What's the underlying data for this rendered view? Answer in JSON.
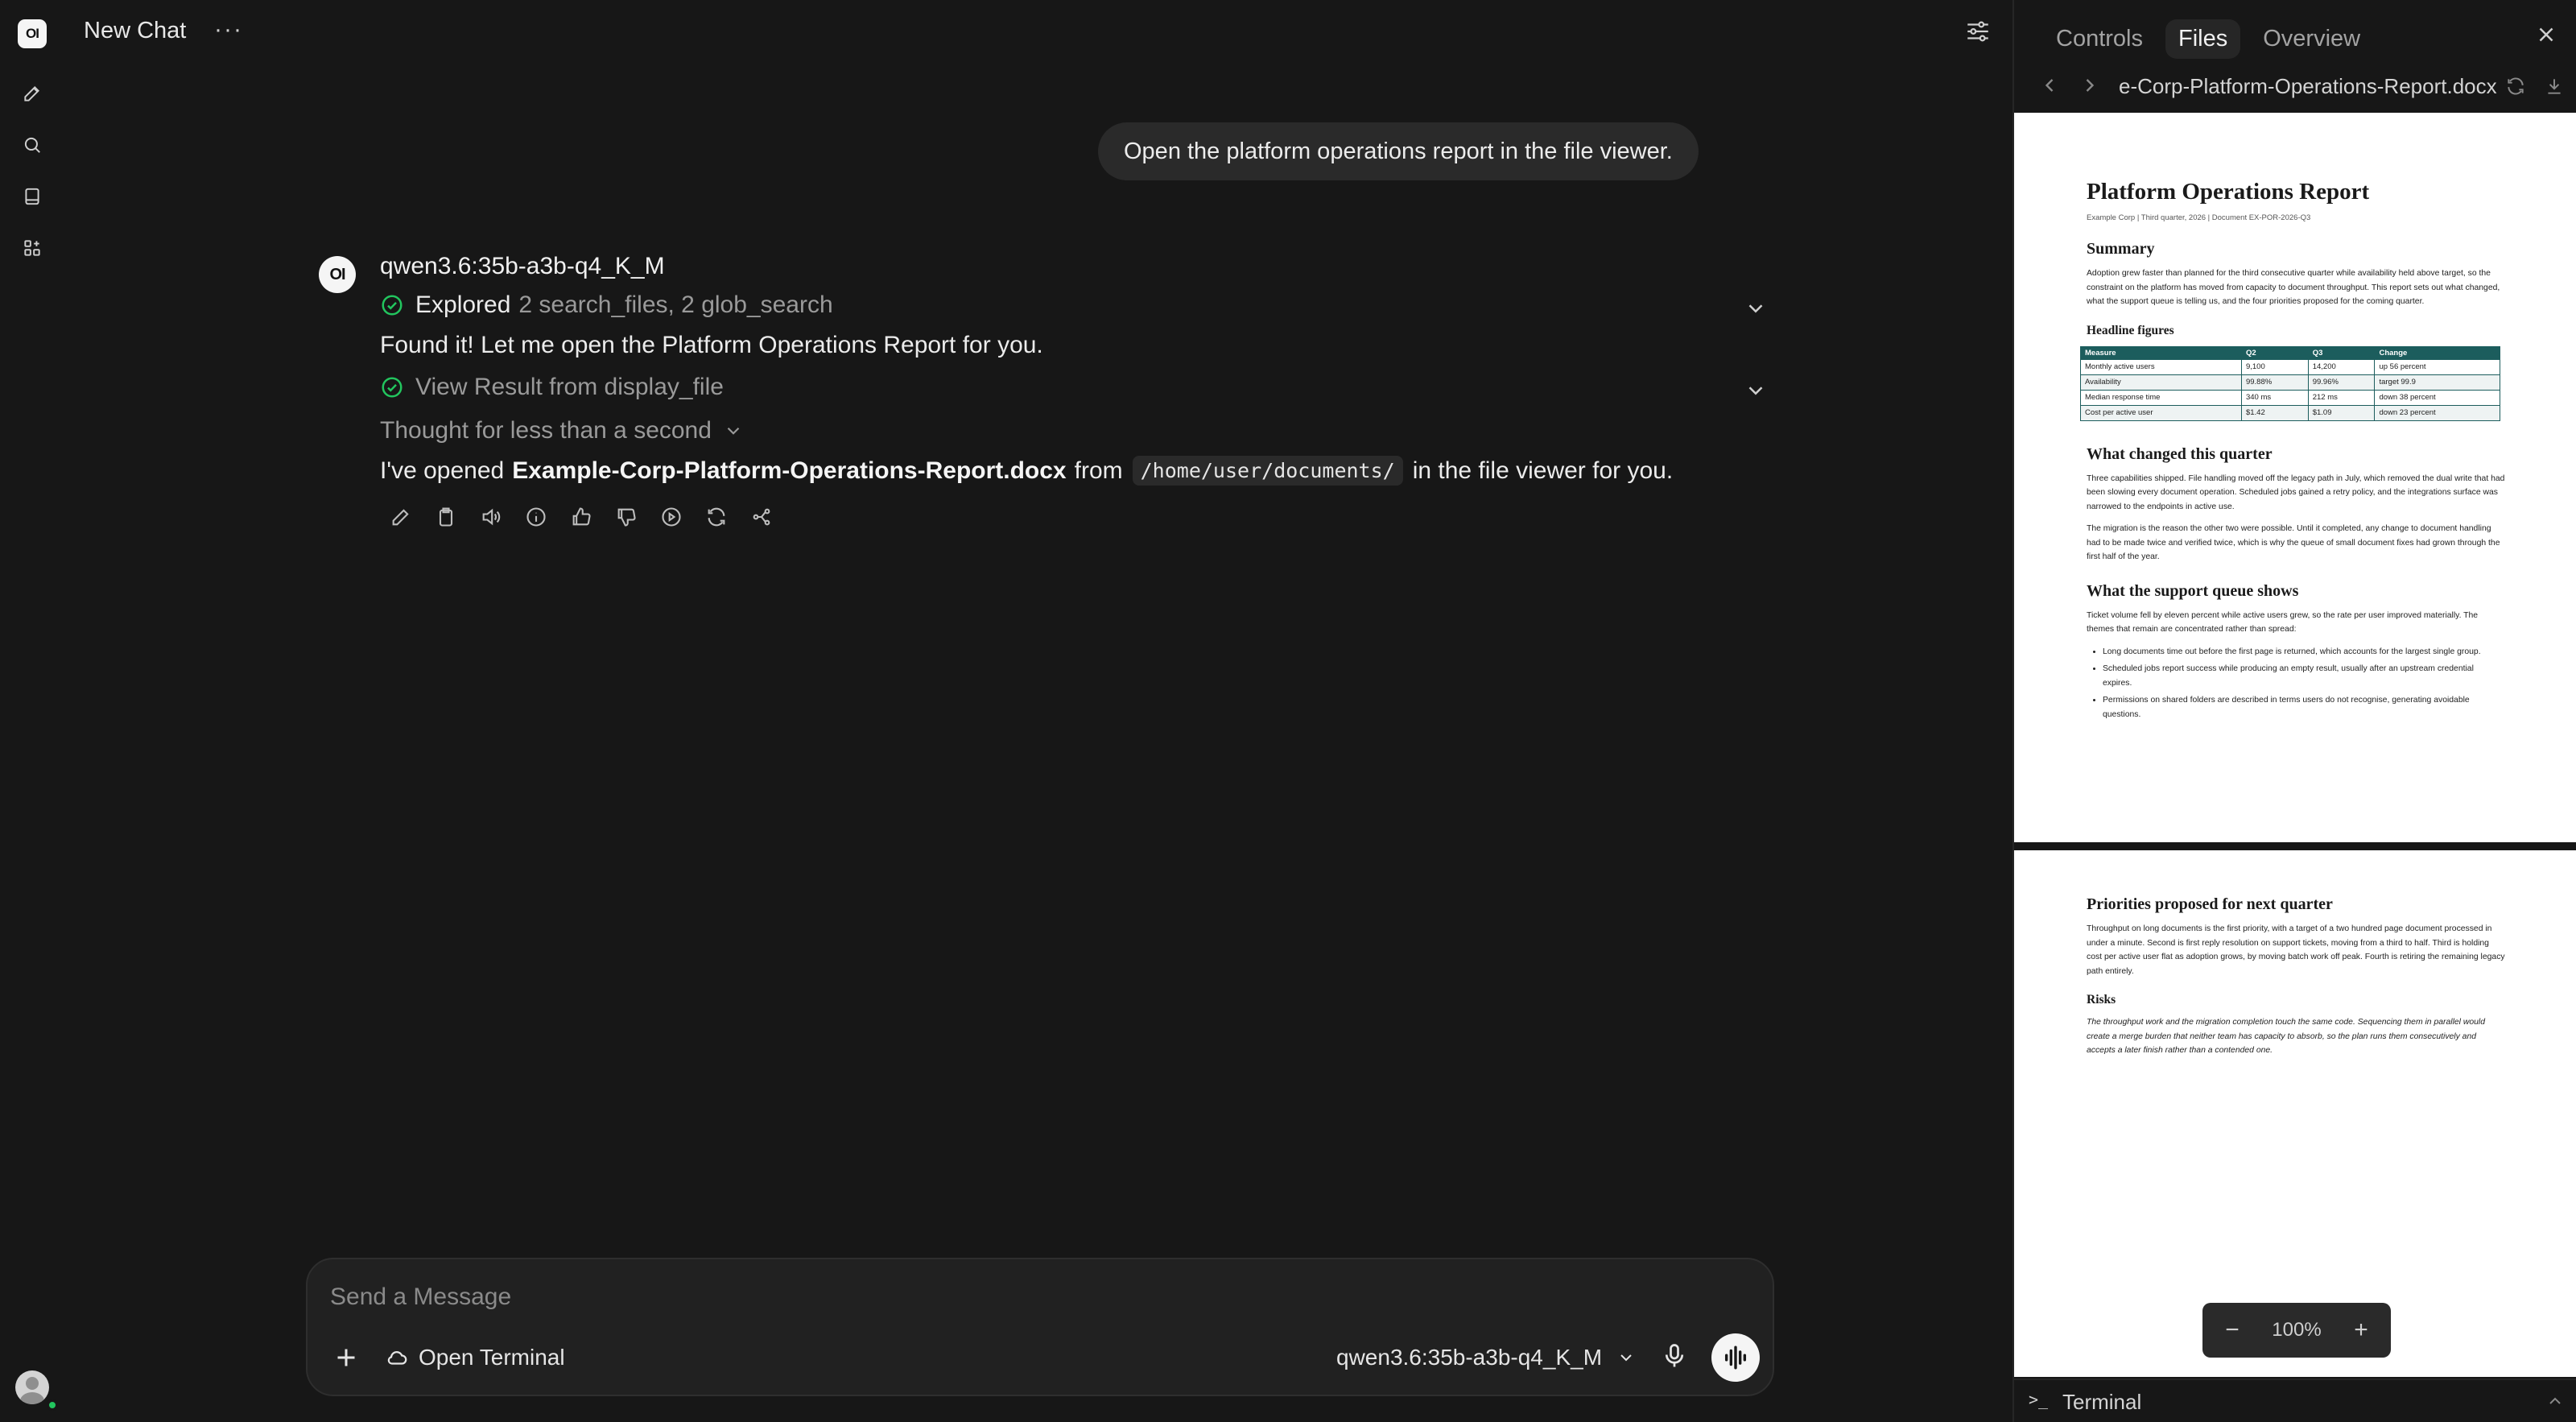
{
  "app": {
    "logo_text": "OI"
  },
  "header": {
    "title": "New Chat",
    "more_label": "···"
  },
  "messages": {
    "user": "Open the platform operations report in the file viewer.",
    "assistant": {
      "avatar_text": "OI",
      "model_name": "qwen3.6:35b-a3b-q4_K_M",
      "explored_label": "Explored",
      "explored_detail": "2 search_files, 2 glob_search",
      "found_text": "Found it! Let me open the Platform Operations Report for you.",
      "view_result_label": "View Result from display_file",
      "thought_label": "Thought for less than a second",
      "final_prefix": "I've opened",
      "final_filename": "Example-Corp-Platform-Operations-Report.docx",
      "final_from": "from",
      "final_path": "/home/user/documents/",
      "final_suffix": "in the file viewer for you."
    }
  },
  "composer": {
    "placeholder": "Send a Message",
    "terminal_label": "Open Terminal",
    "model_label": "qwen3.6:35b-a3b-q4_K_M"
  },
  "panel": {
    "tabs": [
      {
        "label": "Controls"
      },
      {
        "label": "Files"
      },
      {
        "label": "Overview"
      }
    ],
    "active_tab": "Files",
    "file_name": "e-Corp-Platform-Operations-Report.docx",
    "zoom": "100%",
    "zoom_minus": "−",
    "zoom_plus": "+",
    "terminal_label": "Terminal",
    "terminal_prompt": ">_"
  },
  "document": {
    "title": "Platform Operations Report",
    "meta": "Example Corp  |  Third quarter, 2026  |  Document EX-POR-2026-Q3",
    "summary_heading": "Summary",
    "summary_text": "Adoption grew faster than planned for the third consecutive quarter while availability held above target, so the constraint on the platform has moved from capacity to document throughput. This report sets out what changed, what the support queue is telling us, and the four priorities proposed for the coming quarter.",
    "headline_heading": "Headline figures",
    "table": {
      "headers": [
        "Measure",
        "Q2",
        "Q3",
        "Change"
      ],
      "rows": [
        [
          "Monthly active users",
          "9,100",
          "14,200",
          "up 56 percent"
        ],
        [
          "Availability",
          "99.88%",
          "99.96%",
          "target 99.9"
        ],
        [
          "Median response time",
          "340 ms",
          "212 ms",
          "down 38 percent"
        ],
        [
          "Cost per active user",
          "$1.42",
          "$1.09",
          "down 23 percent"
        ]
      ]
    },
    "changed_heading": "What changed this quarter",
    "changed_p1": "Three capabilities shipped. File handling moved off the legacy path in July, which removed the dual write that had been slowing every document operation. Scheduled jobs gained a retry policy, and the integrations surface was narrowed to the endpoints in active use.",
    "changed_p2": "The migration is the reason the other two were possible. Until it completed, any change to document handling had to be made twice and verified twice, which is why the queue of small document fixes had grown through the first half of the year.",
    "support_heading": "What the support queue shows",
    "support_text": "Ticket volume fell by eleven percent while active users grew, so the rate per user improved materially. The themes that remain are concentrated rather than spread:",
    "support_items": [
      "Long documents time out before the first page is returned, which accounts for the largest single group.",
      "Scheduled jobs report success while producing an empty result, usually after an upstream credential expires.",
      "Permissions on shared folders are described in terms users do not recognise, generating avoidable questions."
    ],
    "priorities_heading": "Priorities proposed for next quarter",
    "priorities_text": "Throughput on long documents is the first priority, with a target of a two hundred page document processed in under a minute. Second is first reply resolution on support tickets, moving from a third to half. Third is holding cost per active user flat as adoption grows, by moving batch work off peak. Fourth is retiring the remaining legacy path entirely.",
    "risks_heading": "Risks",
    "risks_text": "The throughput work and the migration completion touch the same code. Sequencing them in parallel would create a merge burden that neither team has capacity to absorb, so the plan runs them consecutively and accepts a later finish rather than a contended one."
  },
  "colors": {
    "accent_check": "#22c55e",
    "table_header": "#1c5d5d"
  }
}
